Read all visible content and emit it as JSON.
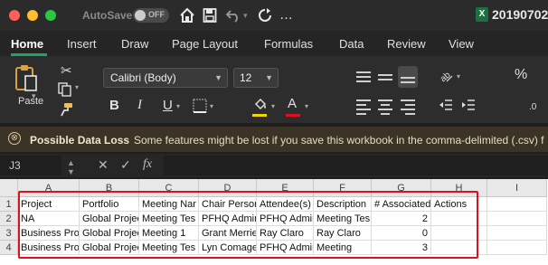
{
  "titlebar": {
    "autosave_label": "AutoSave",
    "autosave_state": "OFF",
    "file_badge": "X",
    "filename": "20190702"
  },
  "tabs": [
    "Home",
    "Insert",
    "Draw",
    "Page Layout",
    "Formulas",
    "Data",
    "Review",
    "View"
  ],
  "ribbon": {
    "paste_label": "Paste",
    "font_name": "Calibri (Body)",
    "font_size": "12",
    "bold": "B",
    "italic": "I",
    "underline": "U",
    "font_color_letter": "A",
    "fill_color": "#f5d400",
    "font_color": "#e0101e",
    "percent_label": "%"
  },
  "message_bar": {
    "icon": "⊗",
    "title": "Possible Data Loss",
    "body": "Some features might be lost if you save this workbook in the comma-delimited (.csv) f"
  },
  "formula_bar": {
    "name_box": "J3",
    "fx": "fx",
    "value": ""
  },
  "sheet": {
    "columns": [
      "A",
      "B",
      "C",
      "D",
      "E",
      "F",
      "G",
      "H",
      "I"
    ],
    "rows": [
      "1",
      "2",
      "3",
      "4"
    ],
    "cells": [
      [
        "Project",
        "Portfolio",
        "Meeting Nar",
        "Chair Person",
        "Attendee(s)",
        "Description",
        "# Associated",
        "Actions",
        ""
      ],
      [
        "NA",
        "Global Projec",
        "Meeting Tes",
        "PFHQ Admin",
        "PFHQ Admin",
        "Meeting Tes",
        "2",
        "",
        ""
      ],
      [
        "Business Pro",
        "Global Projec",
        "Meeting 1",
        "Grant Merrie",
        "Ray Claro",
        "Ray Claro",
        "0",
        "",
        ""
      ],
      [
        "Business Pro",
        "Global Projec",
        "Meeting Tes",
        "Lyn Comages",
        "PFHQ Admin",
        "Meeting",
        "3",
        "",
        ""
      ]
    ],
    "highlight_color": "#e0101e"
  }
}
